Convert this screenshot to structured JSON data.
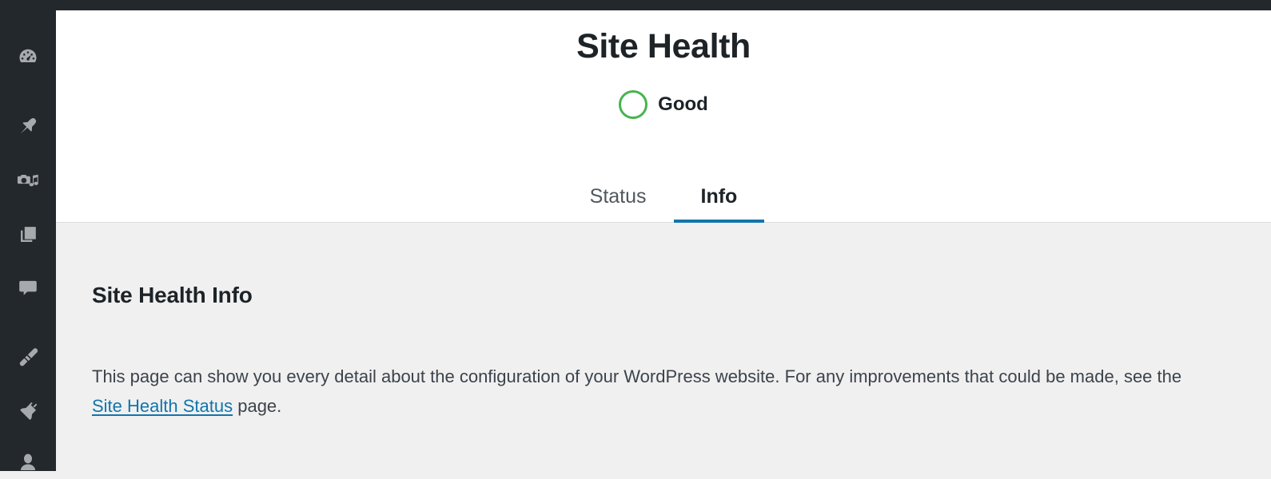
{
  "admin_bar": {
    "present": true
  },
  "sidebar": {
    "background_color": "#23282d",
    "icon_color": "#a7aaad",
    "items": [
      {
        "name": "menu-item-partial-top",
        "icon": "partial-icon",
        "label": ""
      },
      {
        "name": "menu-item-dashboard",
        "icon": "dashboard-icon",
        "label": "Dashboard"
      },
      {
        "name": "menu-item-posts",
        "icon": "pin-icon",
        "label": "Posts"
      },
      {
        "name": "menu-item-media",
        "icon": "camera-music-icon",
        "label": "Media"
      },
      {
        "name": "menu-item-pages",
        "icon": "pages-icon",
        "label": "Pages"
      },
      {
        "name": "menu-item-comments",
        "icon": "comment-bubble-icon",
        "label": "Comments"
      },
      {
        "name": "menu-item-appearance",
        "icon": "paintbrush-icon",
        "label": "Appearance"
      },
      {
        "name": "menu-item-plugins",
        "icon": "plug-icon",
        "label": "Plugins"
      },
      {
        "name": "menu-item-users",
        "icon": "user-icon",
        "label": "Users"
      }
    ]
  },
  "header": {
    "title": "Site Health",
    "status": {
      "label": "Good",
      "indicator_color": "#46b450"
    }
  },
  "tabs": {
    "active": "Info",
    "items": [
      {
        "label": "Status",
        "active": false
      },
      {
        "label": "Info",
        "active": true
      }
    ],
    "active_underline_color": "#1275aa"
  },
  "main": {
    "section_title": "Site Health Info",
    "paragraph": {
      "before_link": "This page can show you every detail about the configuration of your WordPress website. For any improvements that could be made, see the ",
      "link_text": "Site Health Status",
      "after_link": " page.",
      "link_color": "#1275aa"
    }
  }
}
